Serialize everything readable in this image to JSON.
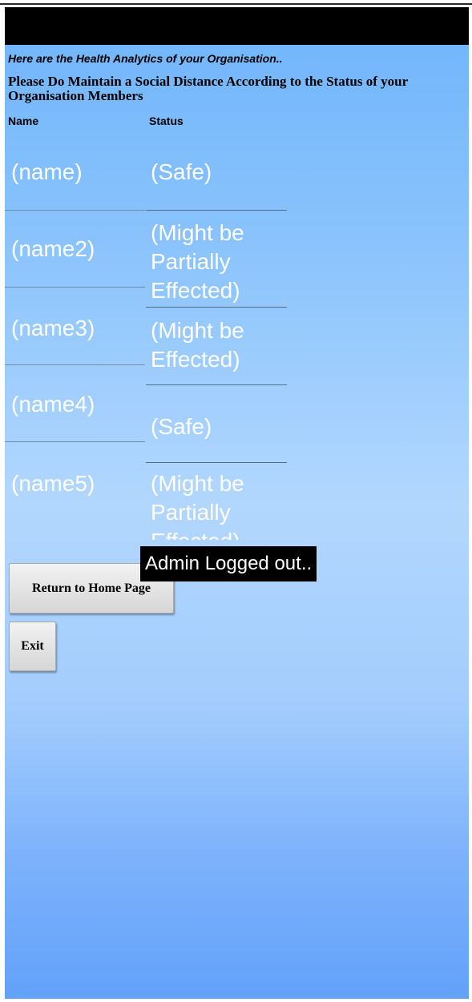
{
  "header": {
    "intro": "Here are the Health Analytics of your Organisation..",
    "notice": "Please Do Maintain a Social Distance According to the Status of your Organisation Members"
  },
  "table": {
    "columns": [
      "Name",
      "Status"
    ],
    "rows": [
      {
        "name": "(name)",
        "status": "(Safe)"
      },
      {
        "name": "(name2)",
        "status": "(Might be Partially Effected)"
      },
      {
        "name": "(name3)",
        "status": "(Might be Effected)"
      },
      {
        "name": "(name4)",
        "status": "(Safe)"
      },
      {
        "name": "(name5)",
        "status": "(Might be Partially Effected)"
      }
    ]
  },
  "buttons": {
    "home": "Return to Home Page",
    "exit": "Exit"
  },
  "toast": "Admin Logged out.."
}
